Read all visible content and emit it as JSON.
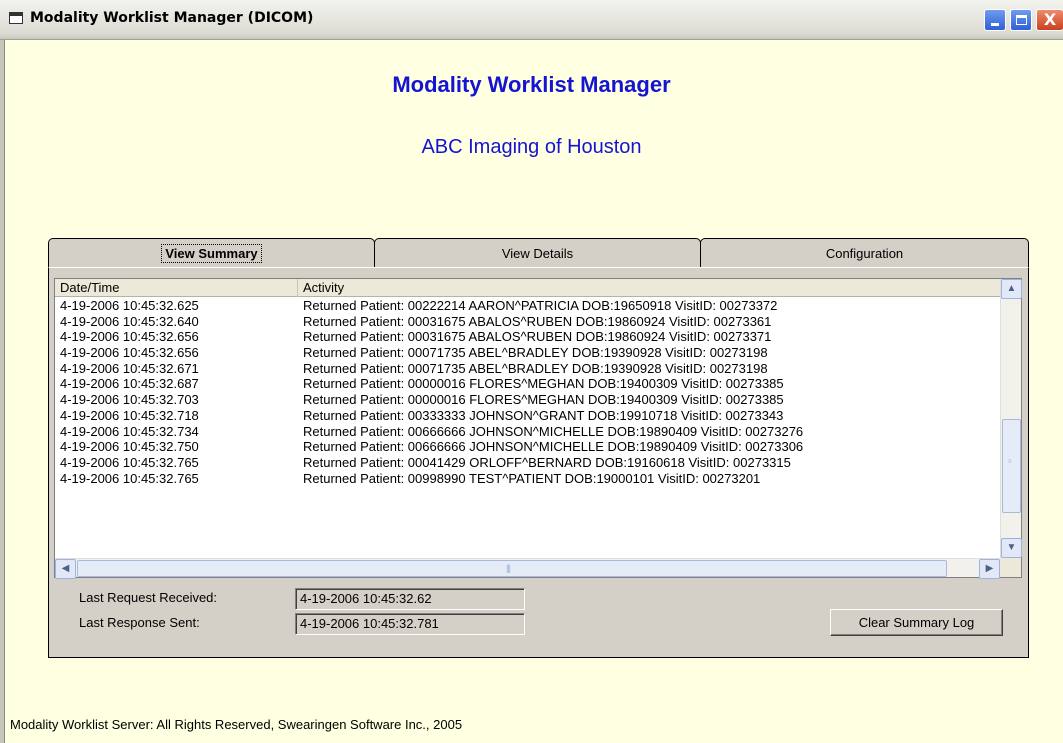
{
  "window": {
    "title": "Modality Worklist Manager (DICOM)",
    "controls": {
      "minimize": "minimize-icon",
      "maximize": "maximize-icon",
      "close_glyph": "X"
    }
  },
  "header": {
    "title": "Modality Worklist Manager",
    "subtitle": "ABC Imaging of Houston"
  },
  "tabs": [
    {
      "label": "View Summary",
      "selected": true
    },
    {
      "label": "View Details",
      "selected": false
    },
    {
      "label": "Configuration",
      "selected": false
    }
  ],
  "log": {
    "columns": [
      "Date/Time",
      "Activity"
    ],
    "rows": [
      {
        "datetime": "4-19-2006 10:45:32.625",
        "activity": "Returned Patient: 00222214 AARON^PATRICIA DOB:19650918 VisitID: 00273372"
      },
      {
        "datetime": "4-19-2006 10:45:32.640",
        "activity": "Returned Patient: 00031675 ABALOS^RUBEN DOB:19860924 VisitID: 00273361"
      },
      {
        "datetime": "4-19-2006 10:45:32.656",
        "activity": "Returned Patient: 00031675 ABALOS^RUBEN DOB:19860924 VisitID: 00273371"
      },
      {
        "datetime": "4-19-2006 10:45:32.656",
        "activity": "Returned Patient: 00071735 ABEL^BRADLEY DOB:19390928 VisitID: 00273198"
      },
      {
        "datetime": "4-19-2006 10:45:32.671",
        "activity": "Returned Patient: 00071735 ABEL^BRADLEY DOB:19390928 VisitID: 00273198"
      },
      {
        "datetime": "4-19-2006 10:45:32.687",
        "activity": "Returned Patient: 00000016 FLORES^MEGHAN DOB:19400309 VisitID: 00273385"
      },
      {
        "datetime": "4-19-2006 10:45:32.703",
        "activity": "Returned Patient: 00000016 FLORES^MEGHAN DOB:19400309 VisitID: 00273385"
      },
      {
        "datetime": "4-19-2006 10:45:32.718",
        "activity": "Returned Patient: 00333333 JOHNSON^GRANT DOB:19910718 VisitID: 00273343"
      },
      {
        "datetime": "4-19-2006 10:45:32.734",
        "activity": "Returned Patient: 00666666 JOHNSON^MICHELLE DOB:19890409 VisitID: 00273276"
      },
      {
        "datetime": "4-19-2006 10:45:32.750",
        "activity": "Returned Patient: 00666666 JOHNSON^MICHELLE DOB:19890409 VisitID: 00273306"
      },
      {
        "datetime": "4-19-2006 10:45:32.765",
        "activity": "Returned Patient: 00041429 ORLOFF^BERNARD DOB:19160618 VisitID: 00273315"
      },
      {
        "datetime": "4-19-2006 10:45:32.765",
        "activity": "Returned Patient: 00998990 TEST^PATIENT DOB:19000101 VisitID: 00273201"
      }
    ]
  },
  "status": {
    "last_request_label": "Last Request Received:",
    "last_request_value": "4-19-2006 10:45:32.62",
    "last_response_label": "Last Response Sent:",
    "last_response_value": "4-19-2006 10:45:32.781"
  },
  "buttons": {
    "clear_log": "Clear Summary Log"
  },
  "footer": {
    "text": "Modality Worklist Server: All Rights Reserved, Swearingen Software Inc., 2005"
  },
  "colors": {
    "background": "#FFFFE1",
    "heading": "#1414D2",
    "panel": "#D4D0C8"
  }
}
